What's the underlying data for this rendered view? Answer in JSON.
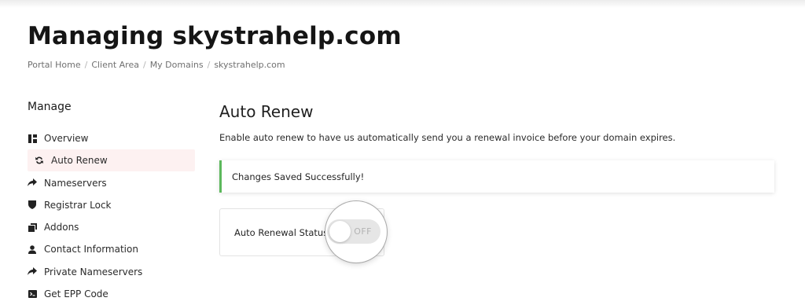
{
  "header": {
    "title": "Managing skystrahelp.com",
    "breadcrumb": [
      "Portal Home",
      "Client Area",
      "My Domains",
      "skystrahelp.com"
    ]
  },
  "sidebar": {
    "title": "Manage",
    "items": [
      {
        "label": "Overview",
        "icon": "overview-icon"
      },
      {
        "label": "Auto Renew",
        "icon": "sync-icon",
        "active": true
      },
      {
        "label": "Nameservers",
        "icon": "share-arrow-icon"
      },
      {
        "label": "Registrar Lock",
        "icon": "shield-icon"
      },
      {
        "label": "Addons",
        "icon": "addons-icon"
      },
      {
        "label": "Contact Information",
        "icon": "user-icon"
      },
      {
        "label": "Private Nameservers",
        "icon": "share-arrow-icon"
      },
      {
        "label": "Get EPP Code",
        "icon": "code-icon"
      }
    ]
  },
  "main": {
    "title": "Auto Renew",
    "description": "Enable auto renew to have us automatically send you a renewal invoice before your domain expires.",
    "alert": "Changes Saved Successfully!",
    "status_label": "Auto Renewal Status:",
    "toggle_text": "OFF"
  },
  "colors": {
    "alert_border": "#5cb85c",
    "active_item_bg": "#fdf1f1",
    "toggle_bg": "#e6e6e6"
  }
}
